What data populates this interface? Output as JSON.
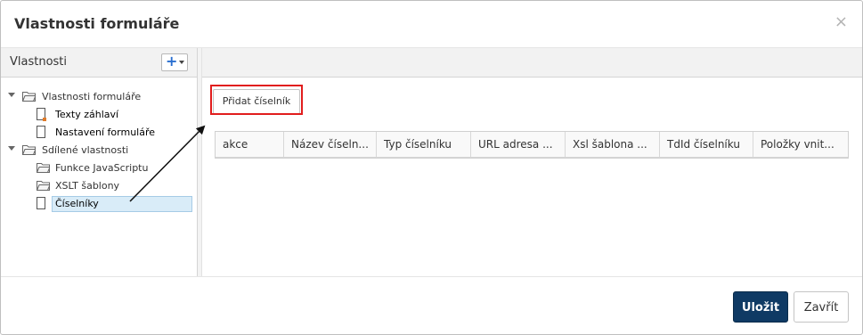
{
  "dialog": {
    "title": "Vlastnosti formuláře",
    "close_glyph": "×"
  },
  "left_panel": {
    "title": "Vlastnosti",
    "add_button_glyph": "+"
  },
  "tree": [
    {
      "label": "Vlastnosti formuláře",
      "type": "folder",
      "expanded": true
    },
    {
      "label": "Texty záhlaví",
      "type": "document",
      "marked": true
    },
    {
      "label": "Nastavení formuláře",
      "type": "document"
    },
    {
      "label": "Sdílené vlastnosti",
      "type": "folder",
      "expanded": true
    },
    {
      "label": "Funkce JavaScriptu",
      "type": "folder"
    },
    {
      "label": "XSLT šablony",
      "type": "folder"
    },
    {
      "label": "Číselníky",
      "type": "document",
      "selected": true
    }
  ],
  "main": {
    "add_button_label": "Přidat číselník",
    "columns": [
      "akce",
      "Název číseln...",
      "Typ číselníku",
      "URL adresa ...",
      "Xsl šablona ...",
      "TdId číselníku",
      "Položky vnit..."
    ]
  },
  "footer": {
    "save_label": "Uložit",
    "close_label": "Zavřít"
  },
  "colors": {
    "accent": "#0f3a64",
    "highlight": "#e11d1d",
    "selection": "#d9ecf8"
  }
}
